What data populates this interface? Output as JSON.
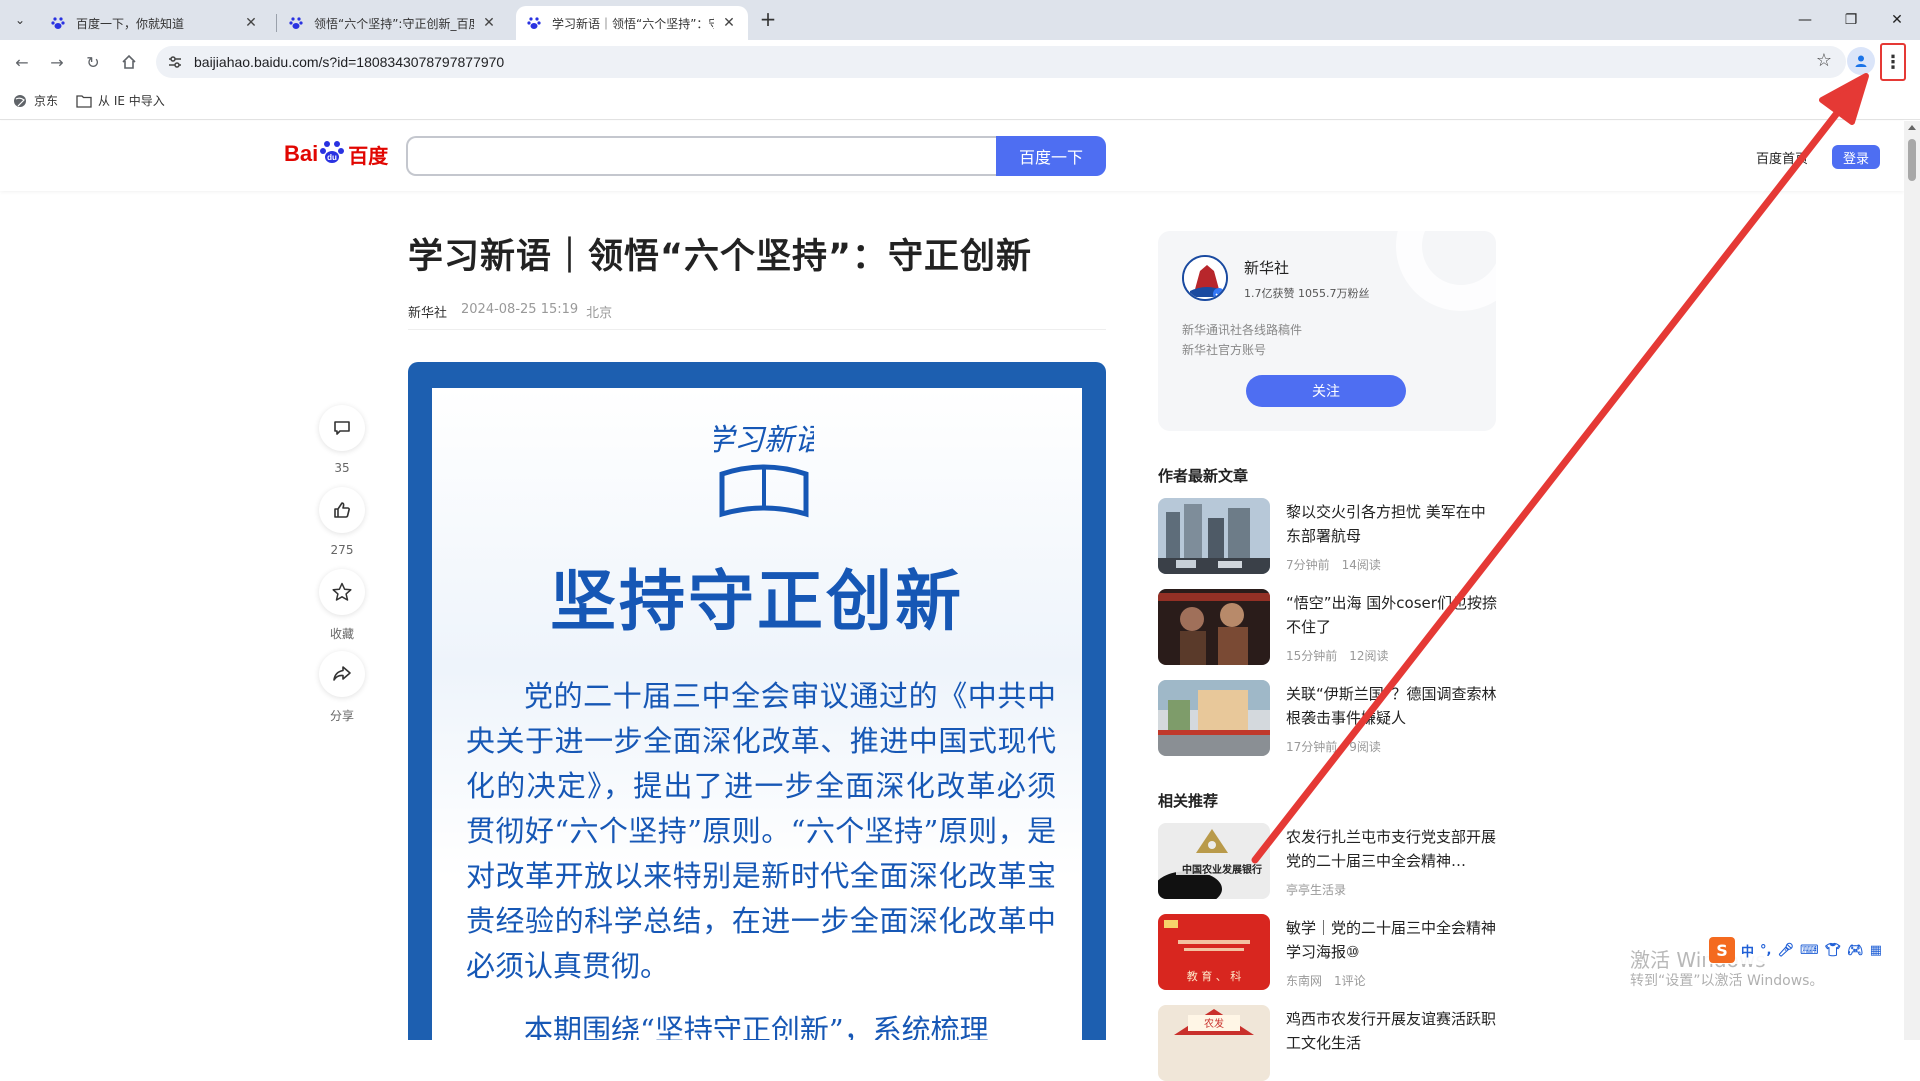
{
  "browser": {
    "tabs": [
      {
        "title": "百度一下，你就知道"
      },
      {
        "title": "领悟“六个坚持”:守正创新_百度..."
      },
      {
        "title": "学习新语｜领悟“六个坚持”：守..."
      }
    ],
    "url": "baijiahao.baidu.com/s?id=1808343078797877970",
    "bookmarks": [
      "京东",
      "从 IE 中导入"
    ],
    "icons": {
      "menu": "more-vert-icon",
      "profile": "profile-icon",
      "star": "bookmark-star-icon"
    }
  },
  "header": {
    "logo_bai": "Bai",
    "logo_du": "百度",
    "search_value": "",
    "search_button": "百度一下",
    "home_link": "百度首页",
    "login_button": "登录"
  },
  "article": {
    "title": "学习新语｜领悟“六个坚持”：守正创新",
    "author": "新华社",
    "datetime": "2024-08-25 15:19",
    "location": "北京"
  },
  "rail": {
    "comments": "35",
    "likes": "275",
    "collect": "收藏",
    "share": "分享"
  },
  "poster": {
    "emblem_text": "学习新语",
    "headline": "坚持守正创新",
    "body": "党的二十届三中全会审议通过的《中共中央关于进一步全面深化改革、推进中国式现代化的决定》，提出了进一步全面深化改革必须贯彻好“六个坚持”原则。“六个坚持”原则，是对改革开放以来特别是新时代全面深化改革宝贵经验的科学总结，在进一步全面深化改革中必须认真贯彻。",
    "body2": "本期围绕“坚持守正创新”，系统梳理"
  },
  "author_card": {
    "name": "新华社",
    "stats": "1.7亿获赞 1055.7万粉丝",
    "desc1": "新华通讯社各线路稿件",
    "desc2": "新华社官方账号",
    "follow": "关注"
  },
  "latest": {
    "heading": "作者最新文章",
    "items": [
      {
        "title": "黎以交火引各方担忧 美军在中东部署航母",
        "time": "7分钟前",
        "reads": "14阅读"
      },
      {
        "title": "“悟空”出海 国外coser们也按捺不住了",
        "time": "15分钟前",
        "reads": "12阅读"
      },
      {
        "title": "关联“伊斯兰国”？德国调查索林根袭击事件嫌疑人",
        "time": "17分钟前",
        "reads": "9阅读"
      }
    ]
  },
  "related": {
    "heading": "相关推荐",
    "items": [
      {
        "title": "农发行扎兰屯市支行党支部开展党的二十届三中全会精神…",
        "source": "亭亭生活录",
        "extra": "",
        "thumb_text": "中国农业发展银行"
      },
      {
        "title": "敏学｜党的二十届三中全会精神学习海报⑩",
        "source": "东南网",
        "extra": "1评论",
        "thumb_text": "教 育 、 科"
      },
      {
        "title": "鸡西市农发行开展友谊赛活跃职工文化生活",
        "source": "",
        "extra": "",
        "thumb_text": "农发"
      }
    ]
  },
  "os": {
    "watermark1": "激活 Windows",
    "watermark2": "转到“设置”以激活 Windows。",
    "ime_mode": "中"
  },
  "colors": {
    "accent": "#4e6ef2",
    "poster_blue": "#1657b5",
    "annotation_red": "#e53935"
  }
}
